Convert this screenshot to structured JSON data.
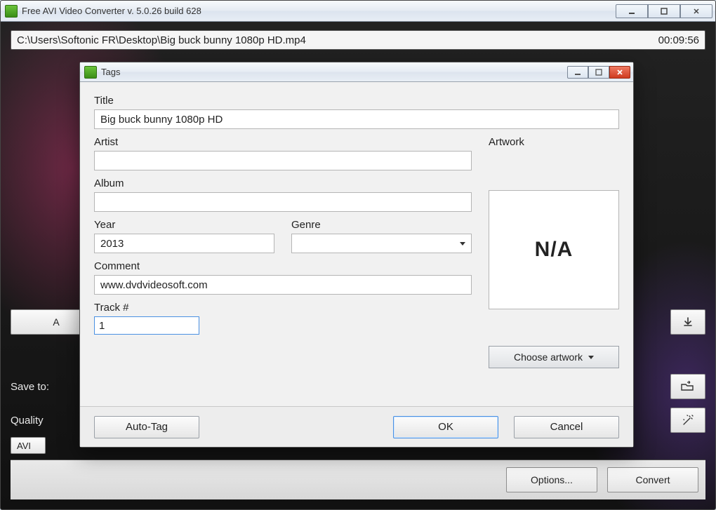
{
  "app": {
    "title": "Free AVI Video Converter  v. 5.0.26 build 628",
    "win_min": "minimize",
    "win_max": "maximize",
    "win_close": "close"
  },
  "file": {
    "path": "C:\\Users\\Softonic FR\\Desktop\\Big buck bunny 1080p HD.mp4",
    "duration": "00:09:56"
  },
  "toolbar": {
    "add_files": "A",
    "save_to_label": "Save to:",
    "quality_label": "Quality",
    "fmt_selected": "AVI"
  },
  "footer": {
    "options": "Options...",
    "convert": "Convert"
  },
  "dialog": {
    "title": "Tags",
    "labels": {
      "title": "Title",
      "artist": "Artist",
      "album": "Album",
      "year": "Year",
      "genre": "Genre",
      "comment": "Comment",
      "track": "Track #",
      "artwork": "Artwork"
    },
    "values": {
      "title": "Big buck bunny 1080p HD",
      "artist": "",
      "album": "",
      "year": "2013",
      "genre": "",
      "comment": "www.dvdvideosoft.com",
      "track": "1",
      "artwork_text": "N/A"
    },
    "choose_artwork": "Choose artwork",
    "buttons": {
      "auto_tag": "Auto-Tag",
      "ok": "OK",
      "cancel": "Cancel"
    }
  }
}
